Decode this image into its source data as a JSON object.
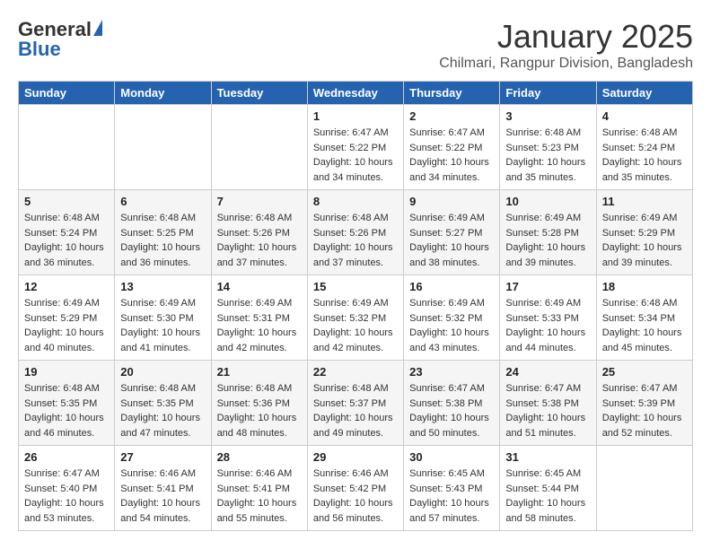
{
  "header": {
    "logo_general": "General",
    "logo_blue": "Blue",
    "month_title": "January 2025",
    "subtitle": "Chilmari, Rangpur Division, Bangladesh"
  },
  "weekdays": [
    "Sunday",
    "Monday",
    "Tuesday",
    "Wednesday",
    "Thursday",
    "Friday",
    "Saturday"
  ],
  "weeks": [
    {
      "days": [
        {
          "num": "",
          "info": ""
        },
        {
          "num": "",
          "info": ""
        },
        {
          "num": "",
          "info": ""
        },
        {
          "num": "1",
          "info": "Sunrise: 6:47 AM\nSunset: 5:22 PM\nDaylight: 10 hours\nand 34 minutes."
        },
        {
          "num": "2",
          "info": "Sunrise: 6:47 AM\nSunset: 5:22 PM\nDaylight: 10 hours\nand 34 minutes."
        },
        {
          "num": "3",
          "info": "Sunrise: 6:48 AM\nSunset: 5:23 PM\nDaylight: 10 hours\nand 35 minutes."
        },
        {
          "num": "4",
          "info": "Sunrise: 6:48 AM\nSunset: 5:24 PM\nDaylight: 10 hours\nand 35 minutes."
        }
      ]
    },
    {
      "days": [
        {
          "num": "5",
          "info": "Sunrise: 6:48 AM\nSunset: 5:24 PM\nDaylight: 10 hours\nand 36 minutes."
        },
        {
          "num": "6",
          "info": "Sunrise: 6:48 AM\nSunset: 5:25 PM\nDaylight: 10 hours\nand 36 minutes."
        },
        {
          "num": "7",
          "info": "Sunrise: 6:48 AM\nSunset: 5:26 PM\nDaylight: 10 hours\nand 37 minutes."
        },
        {
          "num": "8",
          "info": "Sunrise: 6:48 AM\nSunset: 5:26 PM\nDaylight: 10 hours\nand 37 minutes."
        },
        {
          "num": "9",
          "info": "Sunrise: 6:49 AM\nSunset: 5:27 PM\nDaylight: 10 hours\nand 38 minutes."
        },
        {
          "num": "10",
          "info": "Sunrise: 6:49 AM\nSunset: 5:28 PM\nDaylight: 10 hours\nand 39 minutes."
        },
        {
          "num": "11",
          "info": "Sunrise: 6:49 AM\nSunset: 5:29 PM\nDaylight: 10 hours\nand 39 minutes."
        }
      ]
    },
    {
      "days": [
        {
          "num": "12",
          "info": "Sunrise: 6:49 AM\nSunset: 5:29 PM\nDaylight: 10 hours\nand 40 minutes."
        },
        {
          "num": "13",
          "info": "Sunrise: 6:49 AM\nSunset: 5:30 PM\nDaylight: 10 hours\nand 41 minutes."
        },
        {
          "num": "14",
          "info": "Sunrise: 6:49 AM\nSunset: 5:31 PM\nDaylight: 10 hours\nand 42 minutes."
        },
        {
          "num": "15",
          "info": "Sunrise: 6:49 AM\nSunset: 5:32 PM\nDaylight: 10 hours\nand 42 minutes."
        },
        {
          "num": "16",
          "info": "Sunrise: 6:49 AM\nSunset: 5:32 PM\nDaylight: 10 hours\nand 43 minutes."
        },
        {
          "num": "17",
          "info": "Sunrise: 6:49 AM\nSunset: 5:33 PM\nDaylight: 10 hours\nand 44 minutes."
        },
        {
          "num": "18",
          "info": "Sunrise: 6:48 AM\nSunset: 5:34 PM\nDaylight: 10 hours\nand 45 minutes."
        }
      ]
    },
    {
      "days": [
        {
          "num": "19",
          "info": "Sunrise: 6:48 AM\nSunset: 5:35 PM\nDaylight: 10 hours\nand 46 minutes."
        },
        {
          "num": "20",
          "info": "Sunrise: 6:48 AM\nSunset: 5:35 PM\nDaylight: 10 hours\nand 47 minutes."
        },
        {
          "num": "21",
          "info": "Sunrise: 6:48 AM\nSunset: 5:36 PM\nDaylight: 10 hours\nand 48 minutes."
        },
        {
          "num": "22",
          "info": "Sunrise: 6:48 AM\nSunset: 5:37 PM\nDaylight: 10 hours\nand 49 minutes."
        },
        {
          "num": "23",
          "info": "Sunrise: 6:47 AM\nSunset: 5:38 PM\nDaylight: 10 hours\nand 50 minutes."
        },
        {
          "num": "24",
          "info": "Sunrise: 6:47 AM\nSunset: 5:38 PM\nDaylight: 10 hours\nand 51 minutes."
        },
        {
          "num": "25",
          "info": "Sunrise: 6:47 AM\nSunset: 5:39 PM\nDaylight: 10 hours\nand 52 minutes."
        }
      ]
    },
    {
      "days": [
        {
          "num": "26",
          "info": "Sunrise: 6:47 AM\nSunset: 5:40 PM\nDaylight: 10 hours\nand 53 minutes."
        },
        {
          "num": "27",
          "info": "Sunrise: 6:46 AM\nSunset: 5:41 PM\nDaylight: 10 hours\nand 54 minutes."
        },
        {
          "num": "28",
          "info": "Sunrise: 6:46 AM\nSunset: 5:41 PM\nDaylight: 10 hours\nand 55 minutes."
        },
        {
          "num": "29",
          "info": "Sunrise: 6:46 AM\nSunset: 5:42 PM\nDaylight: 10 hours\nand 56 minutes."
        },
        {
          "num": "30",
          "info": "Sunrise: 6:45 AM\nSunset: 5:43 PM\nDaylight: 10 hours\nand 57 minutes."
        },
        {
          "num": "31",
          "info": "Sunrise: 6:45 AM\nSunset: 5:44 PM\nDaylight: 10 hours\nand 58 minutes."
        },
        {
          "num": "",
          "info": ""
        }
      ]
    }
  ]
}
